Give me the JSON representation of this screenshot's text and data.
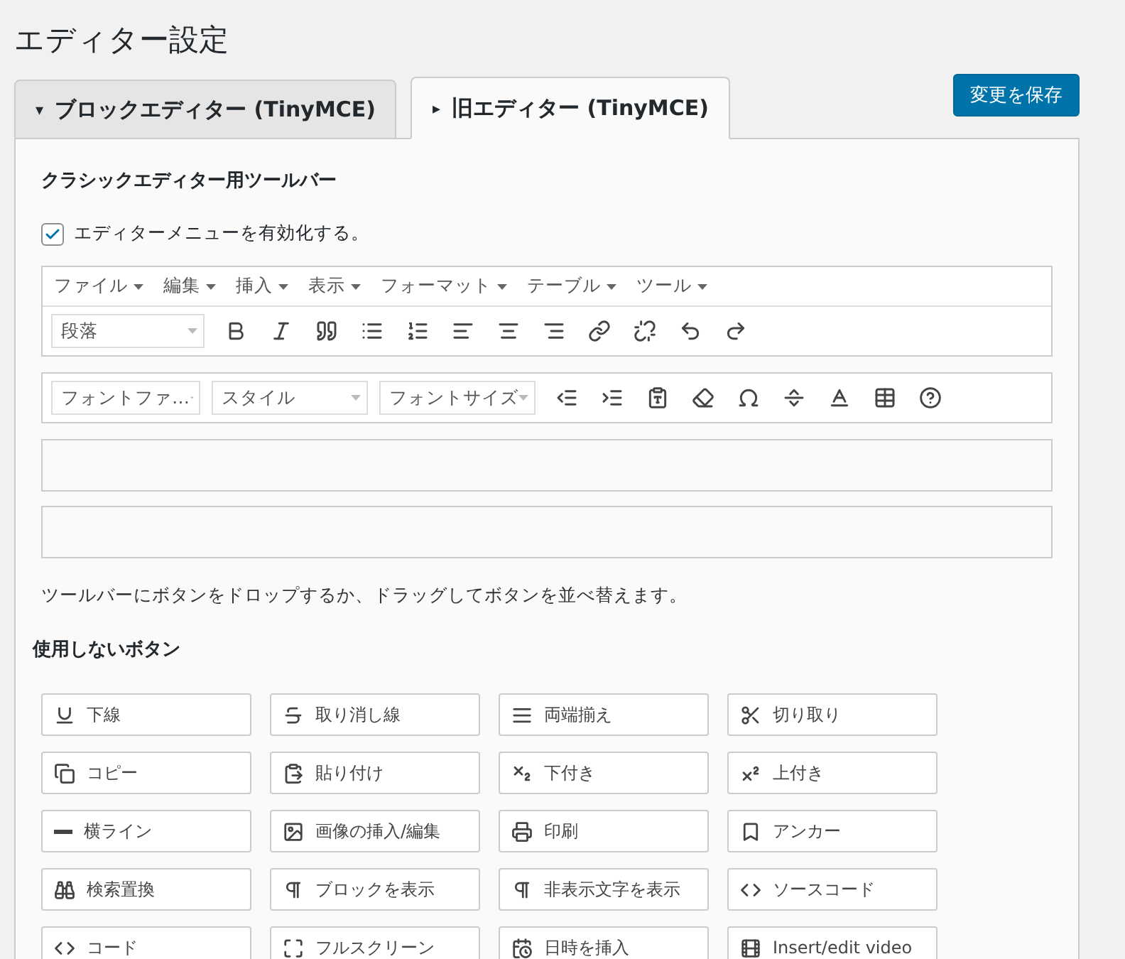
{
  "page": {
    "title": "エディター設定"
  },
  "tabs": [
    {
      "arrow": "▾",
      "label": "ブロックエディター (TinyMCE)",
      "selected": false
    },
    {
      "arrow": "▸",
      "label": "旧エディター (TinyMCE)",
      "selected": true
    }
  ],
  "save_button": "変更を保存",
  "panel": {
    "heading": "クラシックエディター用ツールバー",
    "enable_menu": {
      "label": "エディターメニューを有効化する。",
      "checked": true
    },
    "menubar": [
      "ファイル",
      "編集",
      "挿入",
      "表示",
      "フォーマット",
      "テーブル",
      "ツール"
    ],
    "toolbar_1": {
      "selects": [
        "段落"
      ]
    },
    "toolbar_2": {
      "selects": [
        "フォントファ…",
        "スタイル",
        "フォントサイズ"
      ]
    },
    "hint": "ツールバーにボタンをドロップするか、ドラッグしてボタンを並べ替えます。",
    "unused_heading": "使用しないボタン",
    "unused_buttons": [
      "下線",
      "取り消し線",
      "両端揃え",
      "切り取り",
      "コピー",
      "貼り付け",
      "下付き",
      "上付き",
      "横ライン",
      "画像の挿入/編集",
      "印刷",
      "アンカー",
      "検索置換",
      "ブロックを表示",
      "非表示文字を表示",
      "ソースコード",
      "コード",
      "フルスクリーン",
      "日時を挿入",
      "Insert/edit video"
    ]
  }
}
